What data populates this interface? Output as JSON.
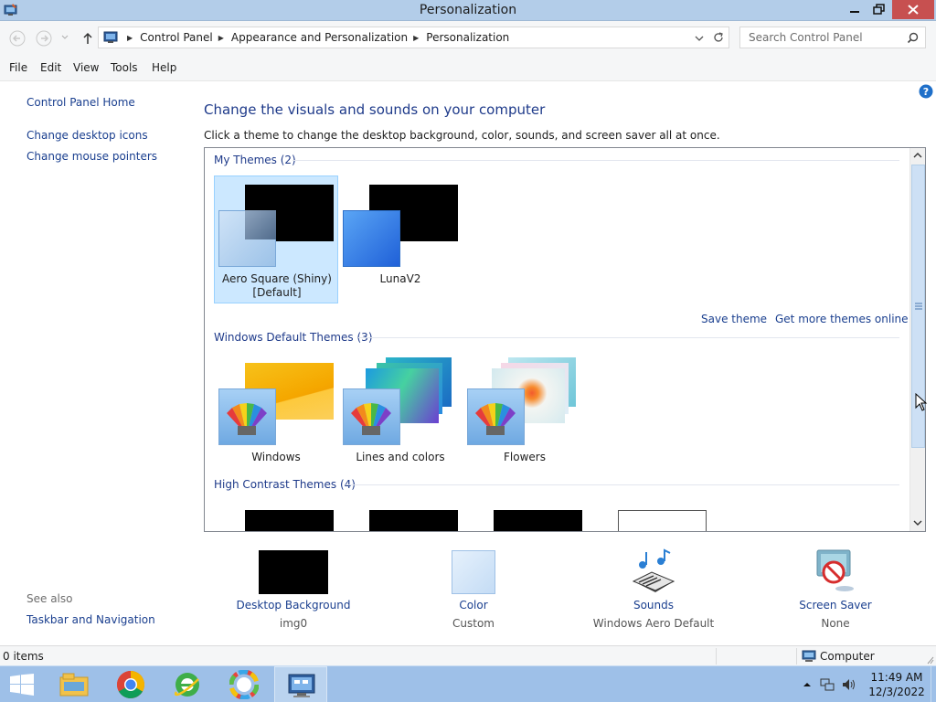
{
  "window": {
    "title": "Personalization"
  },
  "address": {
    "crumbs": [
      "Control Panel",
      "Appearance and Personalization",
      "Personalization"
    ],
    "search_placeholder": "Search Control Panel"
  },
  "menu": {
    "items": [
      "File",
      "Edit",
      "View",
      "Tools",
      "Help"
    ]
  },
  "sidebar": {
    "links": [
      "Control Panel Home",
      "Change desktop icons",
      "Change mouse pointers"
    ],
    "see_also_label": "See also",
    "see_also_links": [
      "Taskbar and Navigation"
    ]
  },
  "main": {
    "title": "Change the visuals and sounds on your computer",
    "subtitle": "Click a theme to change the desktop background, color, sounds, and screen saver all at once."
  },
  "theme_groups": [
    {
      "header": "My Themes (2)",
      "themes": [
        {
          "name_line1": "Aero Square (Shiny)",
          "name_line2": "[Default]",
          "selected": true
        },
        {
          "name_line1": "LunaV2",
          "name_line2": "",
          "selected": false
        }
      ]
    },
    {
      "header": "Windows Default Themes (3)",
      "themes": [
        {
          "name_line1": "Windows"
        },
        {
          "name_line1": "Lines and colors"
        },
        {
          "name_line1": "Flowers"
        }
      ]
    },
    {
      "header": "High Contrast Themes (4)"
    }
  ],
  "theme_links": {
    "save": "Save theme",
    "more": "Get more themes online"
  },
  "settings": [
    {
      "label": "Desktop Background",
      "value": "img0"
    },
    {
      "label": "Color",
      "value": "Custom"
    },
    {
      "label": "Sounds",
      "value": "Windows Aero Default"
    },
    {
      "label": "Screen Saver",
      "value": "None"
    }
  ],
  "status": {
    "items": "0 items",
    "location": "Computer"
  },
  "taskbar": {
    "apps": [
      "start-icon",
      "file-explorer-icon",
      "chrome-icon",
      "ie-icon",
      "photos-icon",
      "control-panel-icon"
    ],
    "time": "11:49 AM",
    "date": "12/3/2022"
  },
  "colors": {
    "link": "#1a3f8f",
    "heading": "#1e3a8a",
    "titlebar": "#b3cde9",
    "taskbar": "#9ec0e8",
    "selection": "#cce8ff"
  }
}
